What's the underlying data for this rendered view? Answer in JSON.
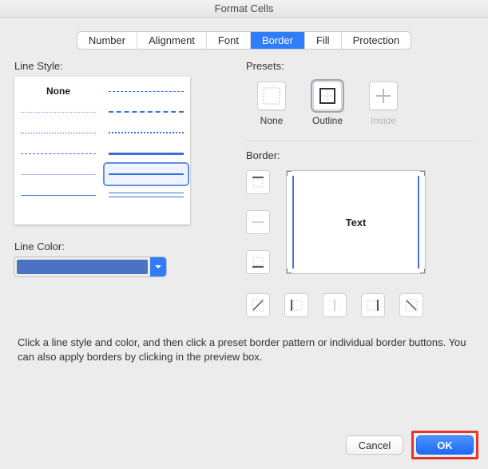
{
  "window": {
    "title": "Format Cells"
  },
  "tabs": {
    "items": [
      "Number",
      "Alignment",
      "Font",
      "Border",
      "Fill",
      "Protection"
    ],
    "active_index": 3
  },
  "left": {
    "line_style_label": "Line Style:",
    "none_label": "None",
    "line_color_label": "Line Color:",
    "color_hex": "#4b73c4"
  },
  "right": {
    "presets_label": "Presets:",
    "presets": {
      "none": "None",
      "outline": "Outline",
      "inside": "Inside"
    },
    "border_label": "Border:",
    "preview_text": "Text"
  },
  "hint": "Click a line style and color, and then click a preset border pattern or individual border buttons. You can also apply borders by clicking in the preview box.",
  "footer": {
    "cancel": "Cancel",
    "ok": "OK"
  }
}
